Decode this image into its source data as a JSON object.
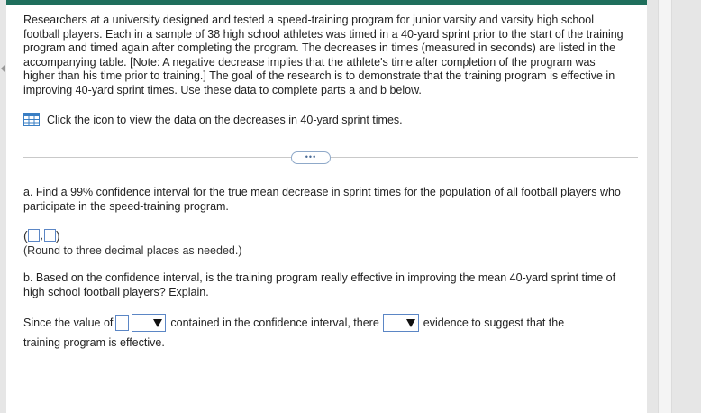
{
  "intro": "Researchers at a university designed and tested a speed-training program for junior varsity and varsity high school football players. Each in a sample of 38 high school athletes was timed in a 40-yard sprint prior to the start of the training program and timed again after completing the program. The decreases in times (measured in seconds) are listed in the accompanying table. [Note: A negative decrease implies that the athlete's time after completion of the program was higher than his time prior to training.] The goal of the research is to demonstrate that the training program is effective in improving 40-yard sprint times. Use these data to complete parts a and b below.",
  "data_link": {
    "icon": "table-grid-icon",
    "text": "Click the icon to view the data on the decreases in 40-yard sprint times."
  },
  "expand_button": "•••",
  "part_a": {
    "question": "a. Find a 99% confidence interval for the true mean decrease in sprint times for the population of all football players who participate in the speed-training program.",
    "open_paren": "(",
    "comma": ",",
    "close_paren": ")",
    "lower_value": "",
    "upper_value": "",
    "hint": "(Round to three decimal places as needed.)"
  },
  "part_b": {
    "question": "b. Based on the confidence interval, is the training program really effective in improving the mean 40-yard sprint time of high school football players? Explain.",
    "since_text": "Since the value of",
    "blank_value": "",
    "contained_text": "contained in the confidence interval, there",
    "evidence_text": "evidence to suggest that the",
    "final_text": "training program is effective.",
    "dropdown1_selected": "",
    "dropdown2_selected": ""
  },
  "colors": {
    "topbar": "#1f6f5c",
    "input_border": "#5b86c5",
    "divider": "#c9c9c9"
  }
}
